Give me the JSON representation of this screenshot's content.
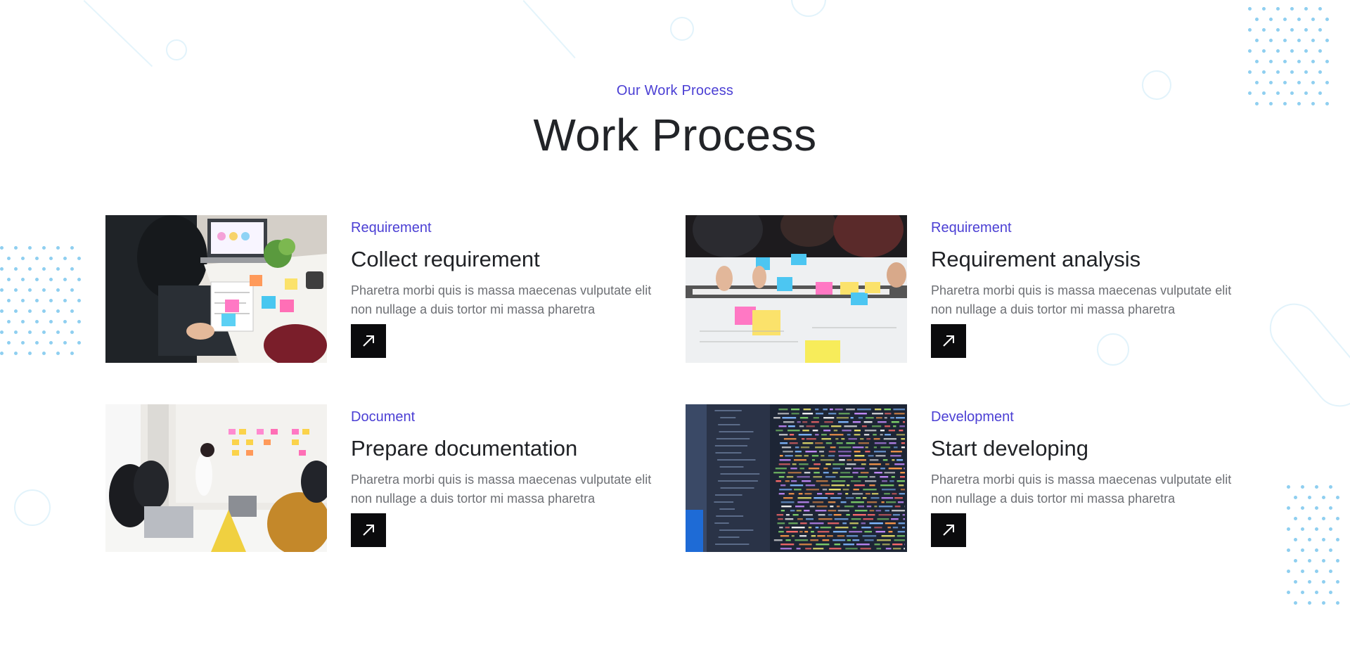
{
  "section": {
    "eyebrow": "Our Work Process",
    "title": "Work Process"
  },
  "cards": [
    {
      "category": "Requirement",
      "title": "Collect requirement",
      "description": "Pharetra morbi quis is massa maecenas vulputate elit non nullage a duis tortor mi massa pharetra",
      "image": "team-planning-wireframes-photo",
      "button_icon": "arrow-up-right-icon"
    },
    {
      "category": "Requirement",
      "title": "Requirement analysis",
      "description": "Pharetra morbi quis is massa maecenas vulputate elit non nullage a duis tortor mi massa pharetra",
      "image": "sticky-notes-user-map-photo",
      "button_icon": "arrow-up-right-icon"
    },
    {
      "category": "Document",
      "title": "Prepare documentation",
      "description": "Pharetra morbi quis is massa maecenas vulputate elit non nullage a duis tortor mi massa pharetra",
      "image": "team-meeting-whiteboard-photo",
      "button_icon": "arrow-up-right-icon"
    },
    {
      "category": "Development",
      "title": "Start developing",
      "description": "Pharetra morbi quis is massa maecenas vulputate elit non nullage a duis tortor mi massa pharetra",
      "image": "source-code-screen-photo",
      "button_icon": "arrow-up-right-icon"
    }
  ],
  "colors": {
    "accent": "#4b3fd4",
    "heading": "#222428",
    "body_text": "#6d6f74",
    "button_bg": "#0b0b0d",
    "decor_dots": "#8fcff0",
    "decor_rings": "#e2f3fb"
  }
}
